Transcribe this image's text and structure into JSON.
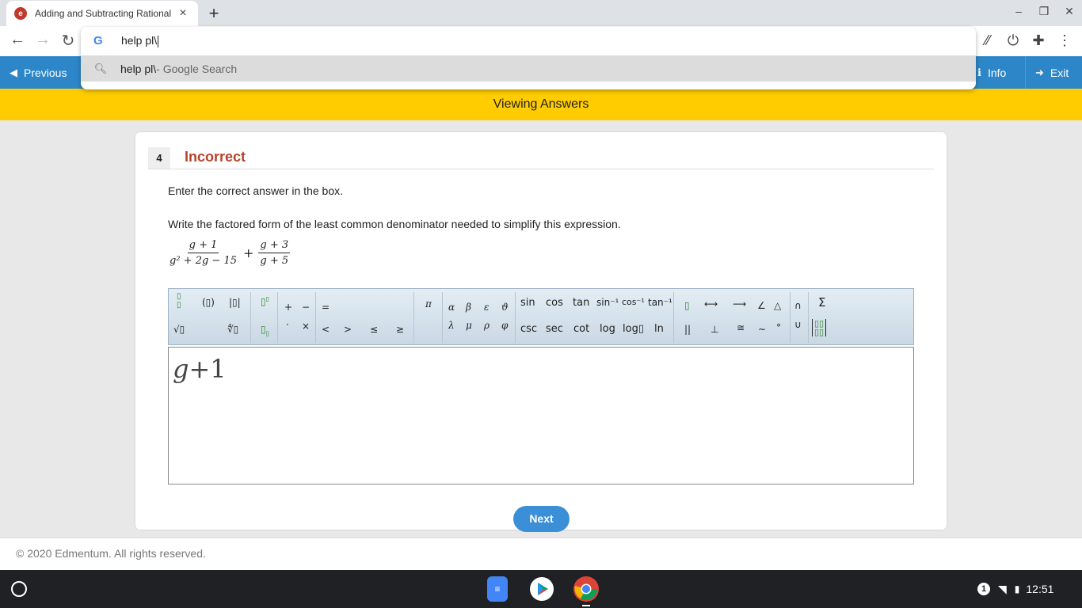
{
  "browser": {
    "tab_title": "Adding and Subtracting Rational Expressions",
    "new_tab": "+",
    "omnibox": {
      "value": "help pl\\",
      "suggestion_query": "help pl\\",
      "suggestion_suffix": " - Google Search"
    }
  },
  "header": {
    "previous_label": "Previous",
    "info_label": "Info",
    "exit_label": "Exit",
    "viewing_label": "Viewing Answers"
  },
  "question": {
    "number": "4",
    "status": "Incorrect",
    "instruction": "Enter the correct answer in the box.",
    "prompt": "Write the factored form of the least common denominator needed to simplify this expression.",
    "expression": {
      "frac1_num": "g + 1",
      "frac1_den": "g² + 2g − 15",
      "operator": "+",
      "frac2_num": "g + 3",
      "frac2_den": "g + 5"
    },
    "answer_var": "g",
    "answer_rest": "+1"
  },
  "keyboard": {
    "row1": {
      "pi": "π",
      "alpha": "α",
      "beta": "β",
      "epsilon": "ε",
      "theta": "ϑ",
      "plus": "+",
      "minus": "−",
      "equals": "=",
      "sin": "sin",
      "cos": "cos",
      "tan": "tan",
      "asin": "sin⁻¹",
      "acos": "cos⁻¹",
      "atan": "tan⁻¹",
      "angle": "∠",
      "triangle": "△",
      "intersect": "∩",
      "sigma": "Σ"
    },
    "row2": {
      "sqrt": "√▯",
      "nthroot": "∜▯",
      "lambda": "λ",
      "mu": "μ",
      "rho": "ρ",
      "phi": "φ",
      "dot": "·",
      "times": "×",
      "lt": "<",
      "gt": ">",
      "le": "≤",
      "ge": "≥",
      "csc": "csc",
      "sec": "sec",
      "cot": "cot",
      "log": "log",
      "logb": "log▯",
      "ln": "ln",
      "parallel": "||",
      "perp": "⊥",
      "congruent": "≅",
      "similar": "~",
      "degree": "°",
      "union": "∪"
    },
    "templates": {
      "fraction": "▯/▯",
      "paren": "(▯)",
      "abs": "|▯|",
      "superscript": "▯▯",
      "subscript": "▯▯",
      "bar": "▯",
      "line": "⟷",
      "ray": "⟶",
      "matrix": "[▯▯]"
    }
  },
  "buttons": {
    "next_label": "Next"
  },
  "footer": {
    "copyright": "© 2020 Edmentum. All rights reserved."
  },
  "taskbar": {
    "notification_count": "1",
    "time": "12:51"
  },
  "colors": {
    "header_blue": "#2c86c8",
    "banner_yellow": "#ffcc00",
    "incorrect_red": "#b5442a",
    "next_blue": "#3b8fd6"
  }
}
